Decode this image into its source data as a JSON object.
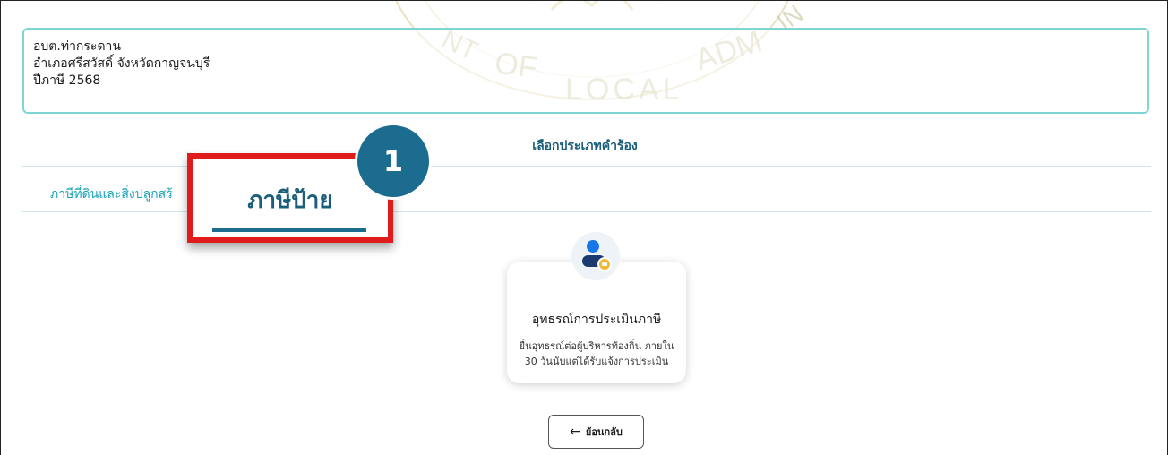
{
  "watermark": {
    "text_left": "NT",
    "text_mid": "OF",
    "text_right": "ADM",
    "text_bottom": "LOCAL",
    "text_far": "IN"
  },
  "info": {
    "org": "อบต.ท่ากระดาน",
    "district": "อำเภอศรีสวัสดิ์ จังหวัดกาญจนบุรี",
    "year": "ปีภาษี 2568"
  },
  "section_title": "เลือกประเภทคำร้อง",
  "tabs": {
    "land": "ภาษีที่ดินและสิ่งปลูกสร้",
    "sign": "ภาษีป้าย"
  },
  "step_badge": "1",
  "card": {
    "icon": "person-badge-icon",
    "title": "อุทธรณ์การประเมินภาษี",
    "desc_line1": "ยื่นอุทธรณ์ต่อผู้บริหารท้องถิ่น ภายใน",
    "desc_line2": "30 วันนับแต่ได้รับแจ้งการประเมิน"
  },
  "back_button": {
    "arrow": "←",
    "label": "ย้อนกลับ"
  },
  "colors": {
    "accent": "#1b6c8f",
    "highlight": "#e01b1b",
    "tab_inactive": "#1aa3b5",
    "info_border": "#7fd4d4"
  }
}
